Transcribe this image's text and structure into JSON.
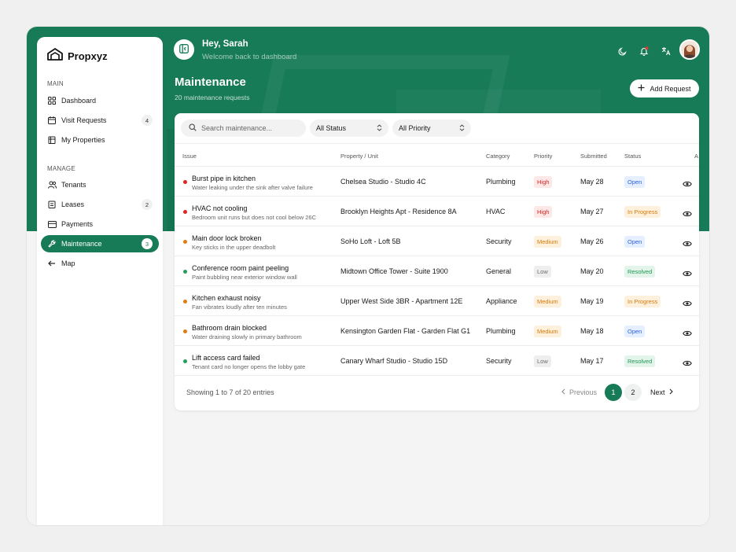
{
  "brand": {
    "name": "Propxyz"
  },
  "sidebar": {
    "sections": [
      "MAIN",
      "MANAGE"
    ],
    "items": [
      {
        "label": "Dashboard",
        "icon": "grid-icon",
        "count": ""
      },
      {
        "label": "Visit Requests",
        "icon": "calendar-icon",
        "count": "4"
      },
      {
        "label": "My Properties",
        "icon": "building-icon",
        "count": ""
      },
      {
        "label": "Tenants",
        "icon": "users-icon",
        "count": ""
      },
      {
        "label": "Leases",
        "icon": "document-icon",
        "count": "2"
      },
      {
        "label": "Payments",
        "icon": "card-icon",
        "count": ""
      },
      {
        "label": "Maintenance",
        "icon": "wrench-icon",
        "count": "3",
        "active": true
      },
      {
        "label": "Map",
        "icon": "arrow-left-icon",
        "count": ""
      }
    ]
  },
  "header": {
    "greeting": "Hey, Sarah",
    "subtitle": "Welcome back to dashboard",
    "icons": [
      "moon-icon",
      "bell-icon",
      "translate-icon"
    ]
  },
  "page": {
    "title": "Maintenance",
    "subtitle": "20 maintenance requests",
    "add_label": "Add Request"
  },
  "filters": {
    "search_placeholder": "Search maintenance...",
    "status": "All Status",
    "priority": "All Priority"
  },
  "table": {
    "columns": [
      "Issue",
      "Property / Unit",
      "Category",
      "Priority",
      "Submitted",
      "Status",
      "A"
    ],
    "rows": [
      {
        "title": "Burst pipe in kitchen",
        "desc": "Water leaking under the sink after valve failure",
        "property": "Chelsea Studio - Studio 4C",
        "category": "Plumbing",
        "priority": "High",
        "submitted": "May 28",
        "status": "Open"
      },
      {
        "title": "HVAC not cooling",
        "desc": "Bedroom unit runs but does not cool below 26C",
        "property": "Brooklyn Heights Apt - Residence 8A",
        "category": "HVAC",
        "priority": "High",
        "submitted": "May 27",
        "status": "In Progress"
      },
      {
        "title": "Main door lock broken",
        "desc": "Key sticks in the upper deadbolt",
        "property": "SoHo Loft - Loft 5B",
        "category": "Security",
        "priority": "Medium",
        "submitted": "May 26",
        "status": "Open"
      },
      {
        "title": "Conference room paint peeling",
        "desc": "Paint bubbling near exterior window wall",
        "property": "Midtown Office Tower - Suite 1900",
        "category": "General",
        "priority": "Low",
        "submitted": "May 20",
        "status": "Resolved"
      },
      {
        "title": "Kitchen exhaust noisy",
        "desc": "Fan vibrates loudly after ten minutes",
        "property": "Upper West Side 3BR - Apartment 12E",
        "category": "Appliance",
        "priority": "Medium",
        "submitted": "May 19",
        "status": "In Progress"
      },
      {
        "title": "Bathroom drain blocked",
        "desc": "Water draining slowly in primary bathroom",
        "property": "Kensington Garden Flat - Garden Flat G1",
        "category": "Plumbing",
        "priority": "Medium",
        "submitted": "May 18",
        "status": "Open"
      },
      {
        "title": "Lift access card failed",
        "desc": "Tenant card no longer opens the lobby gate",
        "property": "Canary Wharf Studio - Studio 15D",
        "category": "Security",
        "priority": "Low",
        "submitted": "May 17",
        "status": "Resolved"
      }
    ]
  },
  "pagination": {
    "summary": "Showing 1 to 7 of 20 entries",
    "prev": "Previous",
    "pages": [
      "1",
      "2"
    ],
    "next": "Next"
  },
  "colors": {
    "brand": "#177b57",
    "high_bg": "#fde8e8",
    "high_fg": "#d32525",
    "medium_bg": "#fdf0dc",
    "medium_fg": "#d97b0a",
    "low_bg": "#eeeeee",
    "low_fg": "#6b6b6b",
    "open_bg": "#e6efff",
    "open_fg": "#2b63d9",
    "progress_bg": "#fdf0dc",
    "progress_fg": "#d97b0a",
    "resolved_bg": "#e3f4ea",
    "resolved_fg": "#1f9a56"
  }
}
